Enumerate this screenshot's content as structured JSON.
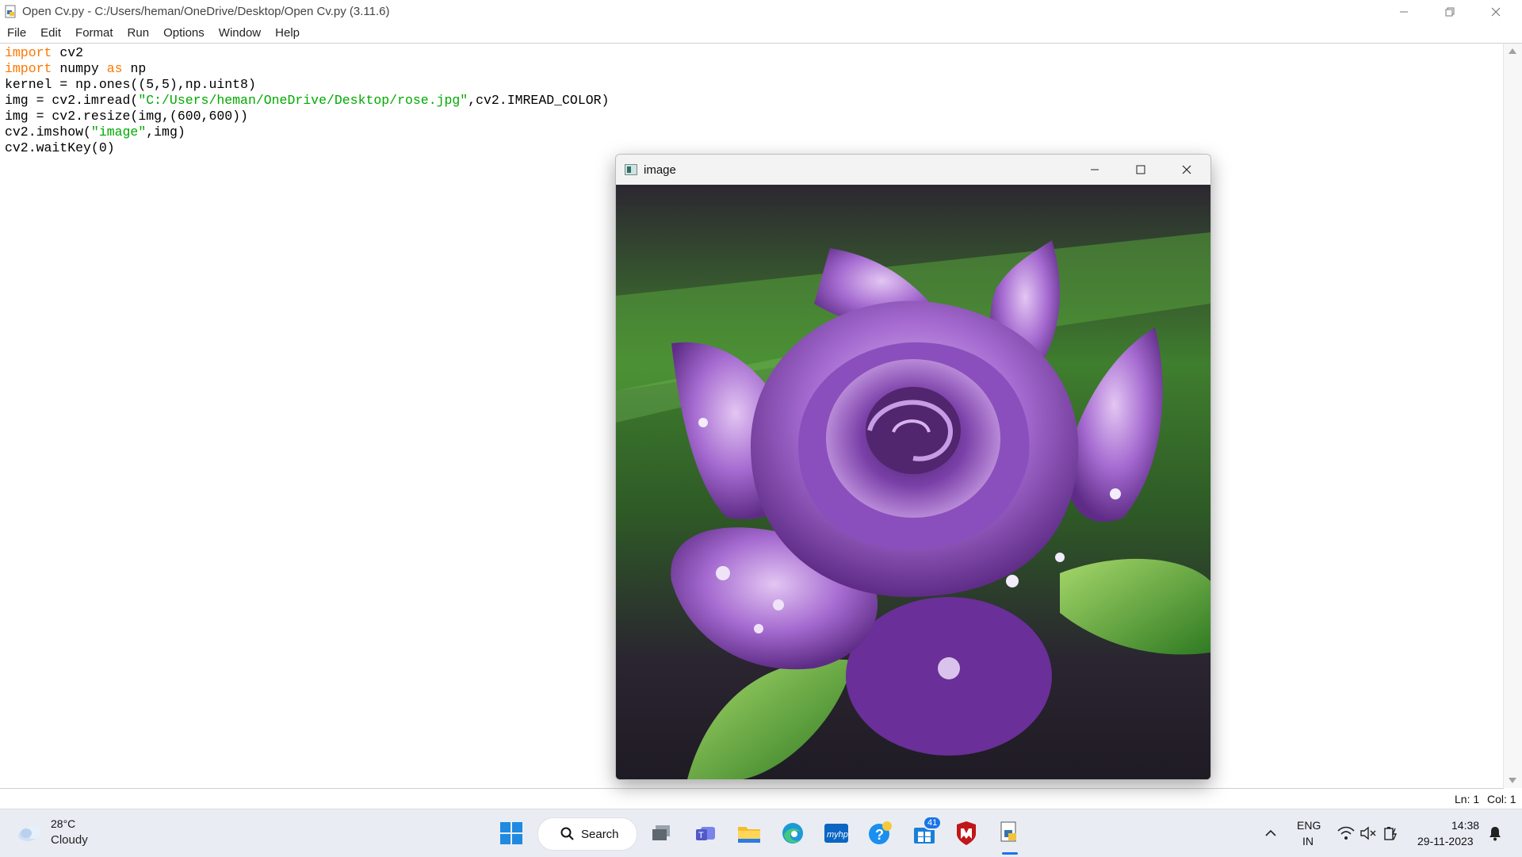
{
  "idle_window": {
    "title": "Open Cv.py - C:/Users/heman/OneDrive/Desktop/Open Cv.py (3.11.6)",
    "menu": [
      "File",
      "Edit",
      "Format",
      "Run",
      "Options",
      "Window",
      "Help"
    ],
    "code_lines": [
      [
        {
          "t": "import",
          "c": "kw"
        },
        {
          "t": " cv2",
          "c": ""
        }
      ],
      [
        {
          "t": "import",
          "c": "kw"
        },
        {
          "t": " numpy ",
          "c": ""
        },
        {
          "t": "as",
          "c": "kw"
        },
        {
          "t": " np",
          "c": ""
        }
      ],
      [
        {
          "t": "kernel = np.ones((5,5),np.uint8)",
          "c": ""
        }
      ],
      [
        {
          "t": "img = cv2.imread(",
          "c": ""
        },
        {
          "t": "\"C:/Users/heman/OneDrive/Desktop/rose.jpg\"",
          "c": "str"
        },
        {
          "t": ",cv2.IMREAD_COLOR)",
          "c": ""
        }
      ],
      [
        {
          "t": "img = cv2.resize(img,(600,600))",
          "c": ""
        }
      ],
      [
        {
          "t": "cv2.imshow(",
          "c": ""
        },
        {
          "t": "\"image\"",
          "c": "str"
        },
        {
          "t": ",img)",
          "c": ""
        }
      ],
      [
        {
          "t": "cv2.waitKey(0)",
          "c": ""
        }
      ]
    ],
    "status": {
      "ln": "Ln: 1",
      "col": "Col: 1"
    }
  },
  "image_window": {
    "title": "image"
  },
  "taskbar": {
    "weather": {
      "temp": "28°C",
      "condition": "Cloudy"
    },
    "search_label": "Search",
    "apps": [
      "start-icon",
      "task-view-icon",
      "teams-icon",
      "file-explorer-icon",
      "edge-icon",
      "myhp-icon",
      "help-icon",
      "store-icon",
      "mcafee-icon",
      "idle-icon"
    ],
    "store_badge": "41",
    "language": {
      "line1": "ENG",
      "line2": "IN"
    },
    "clock": {
      "time": "14:38",
      "date": "29-11-2023"
    }
  },
  "colors": {
    "keyword": "#ff7700",
    "string": "#00aa00",
    "taskbar_bg": "#e9edf3",
    "rose": "#9a5fc8"
  }
}
